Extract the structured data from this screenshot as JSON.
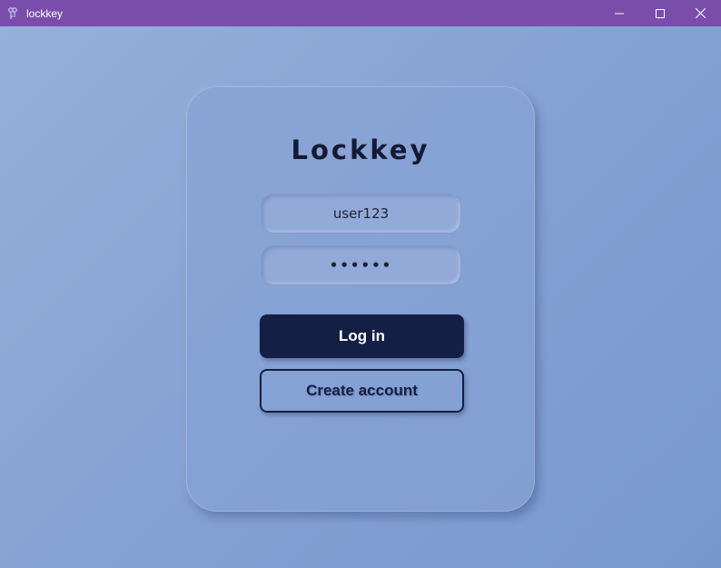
{
  "window": {
    "title": "lockkey",
    "icon": "key-icon",
    "controls": [
      "minimize-icon",
      "maximize-icon",
      "close-icon"
    ]
  },
  "login": {
    "brand": "Lockkey",
    "username_value": "user123",
    "password_value": "••••••",
    "login_label": "Log in",
    "create_label": "Create account"
  },
  "colors": {
    "titlebar": "#7b4dab",
    "background": "#87a2d4",
    "primary_button": "#141f45",
    "text_dark": "#141a33"
  }
}
